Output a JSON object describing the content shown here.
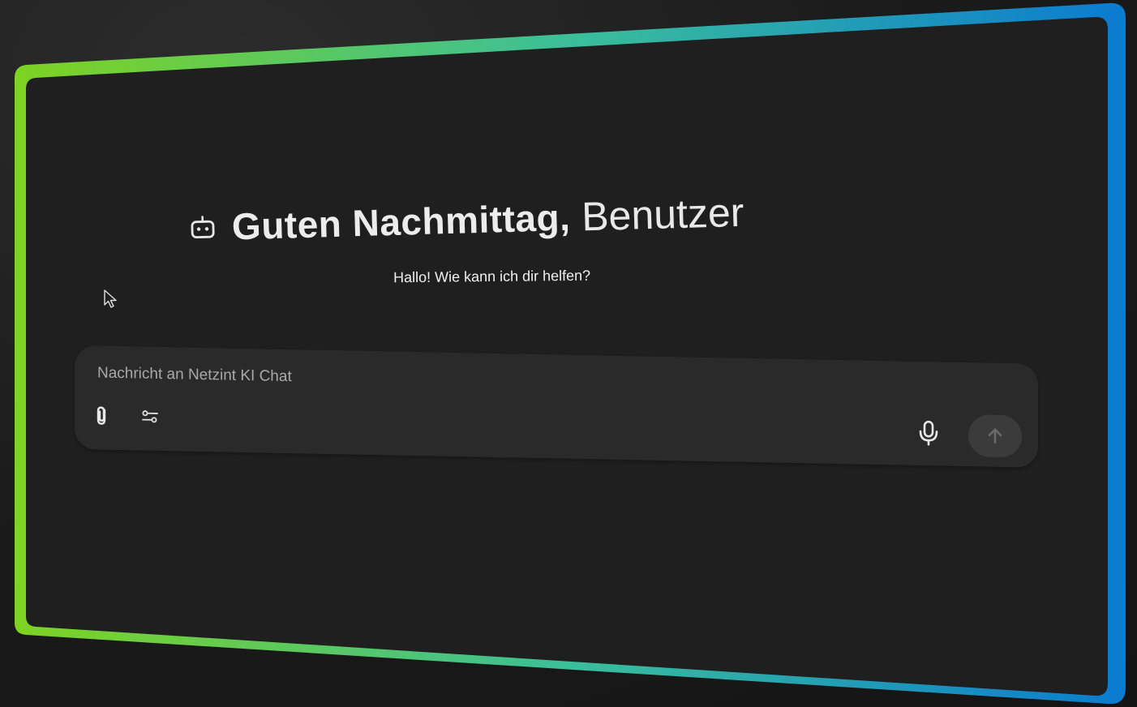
{
  "greeting": {
    "title": "Guten Nachmittag,",
    "name": "Benutzer",
    "subtitle": "Hallo! Wie kann ich dir helfen?",
    "icon": "bot-icon"
  },
  "composer": {
    "placeholder": "Nachricht an Netzint KI Chat",
    "value": "",
    "attach_icon": "paperclip-icon",
    "settings_icon": "sliders-icon",
    "mic_icon": "microphone-icon",
    "send_icon": "arrow-up-icon"
  },
  "colors": {
    "frame_gradient_start": "#7ed321",
    "frame_gradient_end": "#0a7bd0",
    "panel_background": "#1f1f1f",
    "composer_background": "#2a2a2a",
    "send_button_background": "#3b3b3b"
  }
}
